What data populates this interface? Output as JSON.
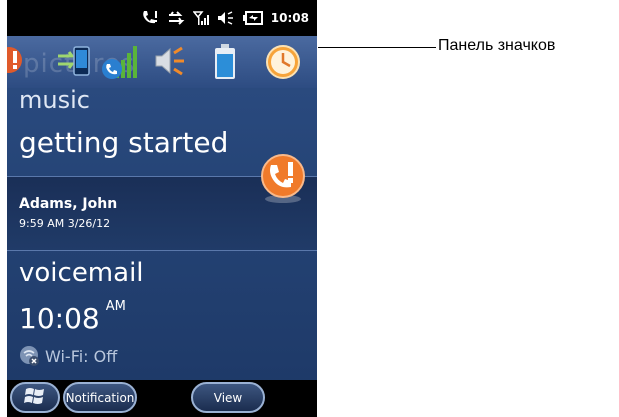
{
  "status_bar": {
    "time": "10:08",
    "icons": [
      "missed-call-icon",
      "data-sync-icon",
      "signal-strength-icon",
      "speaker-icon",
      "battery-charging-icon"
    ]
  },
  "icon_bar": {
    "ghost_text": "pictures",
    "icons": [
      "missed-call-icon",
      "connectivity-icon",
      "phone-signal-icon",
      "volume-icon",
      "battery-icon",
      "clock-icon"
    ]
  },
  "tiles": {
    "music": "music",
    "getting_started": "getting started",
    "notification_name": "Adams, John",
    "notification_time": "9:59 AM 3/26/12",
    "voicemail": "voicemail",
    "time": "10:08",
    "time_suffix": "AM",
    "wifi_status": "Wi-Fi: Off"
  },
  "softkeys": {
    "notification": "Notification",
    "view": "View"
  },
  "callout": {
    "label": "Панель значков"
  },
  "colors": {
    "background": "#254476",
    "status_bar": "#000000",
    "accent_orange": "#f07a2a"
  }
}
